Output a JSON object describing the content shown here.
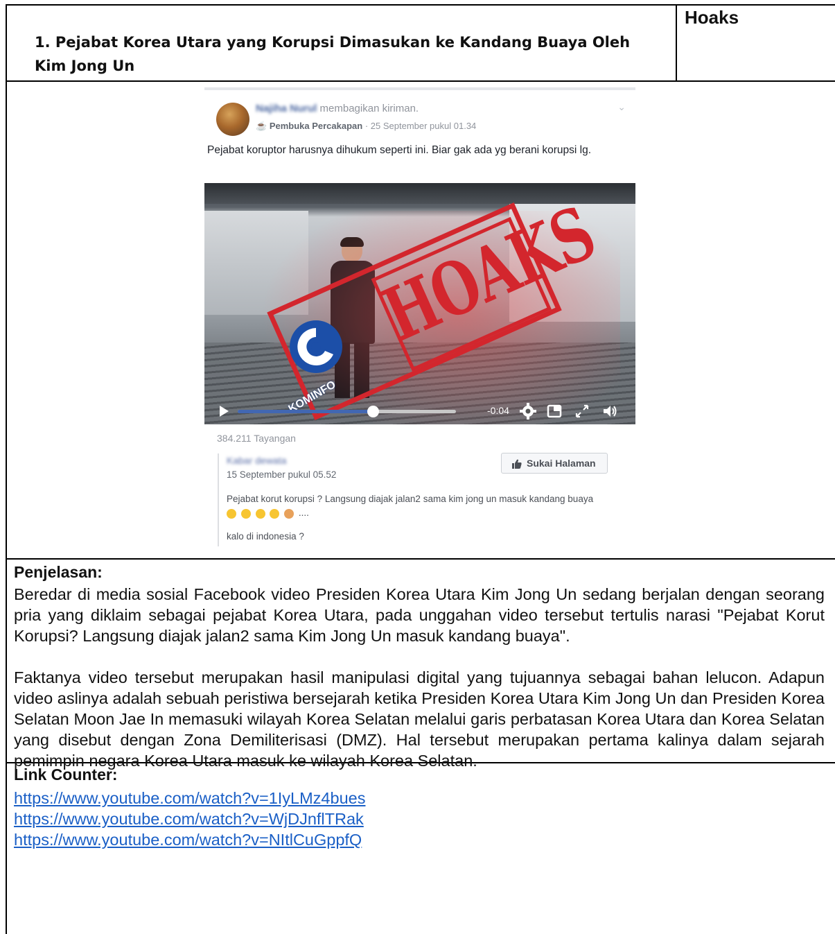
{
  "header": {
    "title": "1. Pejabat Korea Utara yang Korupsi Dimasukan ke Kandang Buaya Oleh Kim Jong Un",
    "verdict": "Hoaks"
  },
  "post": {
    "author": "Najiha Nurul",
    "shared_text": "membagikan kiriman.",
    "group": "Pembuka Percakapan",
    "timestamp": "· 25 September pukul 01.34",
    "text": "Pejabat koruptor harusnya dihukum seperti ini. Biar gak ada yg berani korupsi lg.",
    "stamp": "HOAKS",
    "watermark": "KOMINFO",
    "video_time": "-0:04",
    "progress": 0.62,
    "views": "384.211 Tayangan",
    "page_name": "Kabar dewata",
    "page_date": "15 September pukul 05.52",
    "like_button": "Sukai Halaman",
    "comment_text": "Pejabat korut korupsi ? Langsung diajak jalan2 sama kim jong un masuk kandang buaya",
    "comment_suffix": "....",
    "comment_text2": "kalo di indonesia ?"
  },
  "explanation": {
    "heading": "Penjelasan:",
    "paragraph1": "Beredar di media sosial Facebook video Presiden Korea Utara Kim Jong Un sedang berjalan dengan seorang pria yang diklaim sebagai pejabat Korea Utara, pada unggahan video tersebut tertulis narasi \"Pejabat Korut Korupsi? Langsung diajak jalan2 sama Kim Jong Un masuk kandang buaya\".",
    "paragraph2": "Faktanya video tersebut merupakan hasil manipulasi digital yang tujuannya sebagai bahan lelucon. Adapun video aslinya adalah sebuah peristiwa bersejarah ketika Presiden Korea Utara Kim Jong Un dan Presiden Korea Selatan Moon Jae In memasuki wilayah Korea Selatan melalui garis perbatasan Korea Utara dan Korea Selatan yang disebut dengan Zona Demiliterisasi (DMZ). Hal tersebut merupakan pertama kalinya dalam sejarah pemimpin negara Korea Utara masuk ke wilayah Korea Selatan."
  },
  "links": {
    "heading": "Link Counter:",
    "items": [
      "https://www.youtube.com/watch?v=1IyLMz4bues",
      "https://www.youtube.com/watch?v=WjDJnflTRak",
      "https://www.youtube.com/watch?v=NItlCuGppfQ"
    ]
  },
  "colors": {
    "stamp_red": "#d3262d",
    "progress_blue": "#4267b2",
    "link_blue": "#1a5fc6"
  }
}
